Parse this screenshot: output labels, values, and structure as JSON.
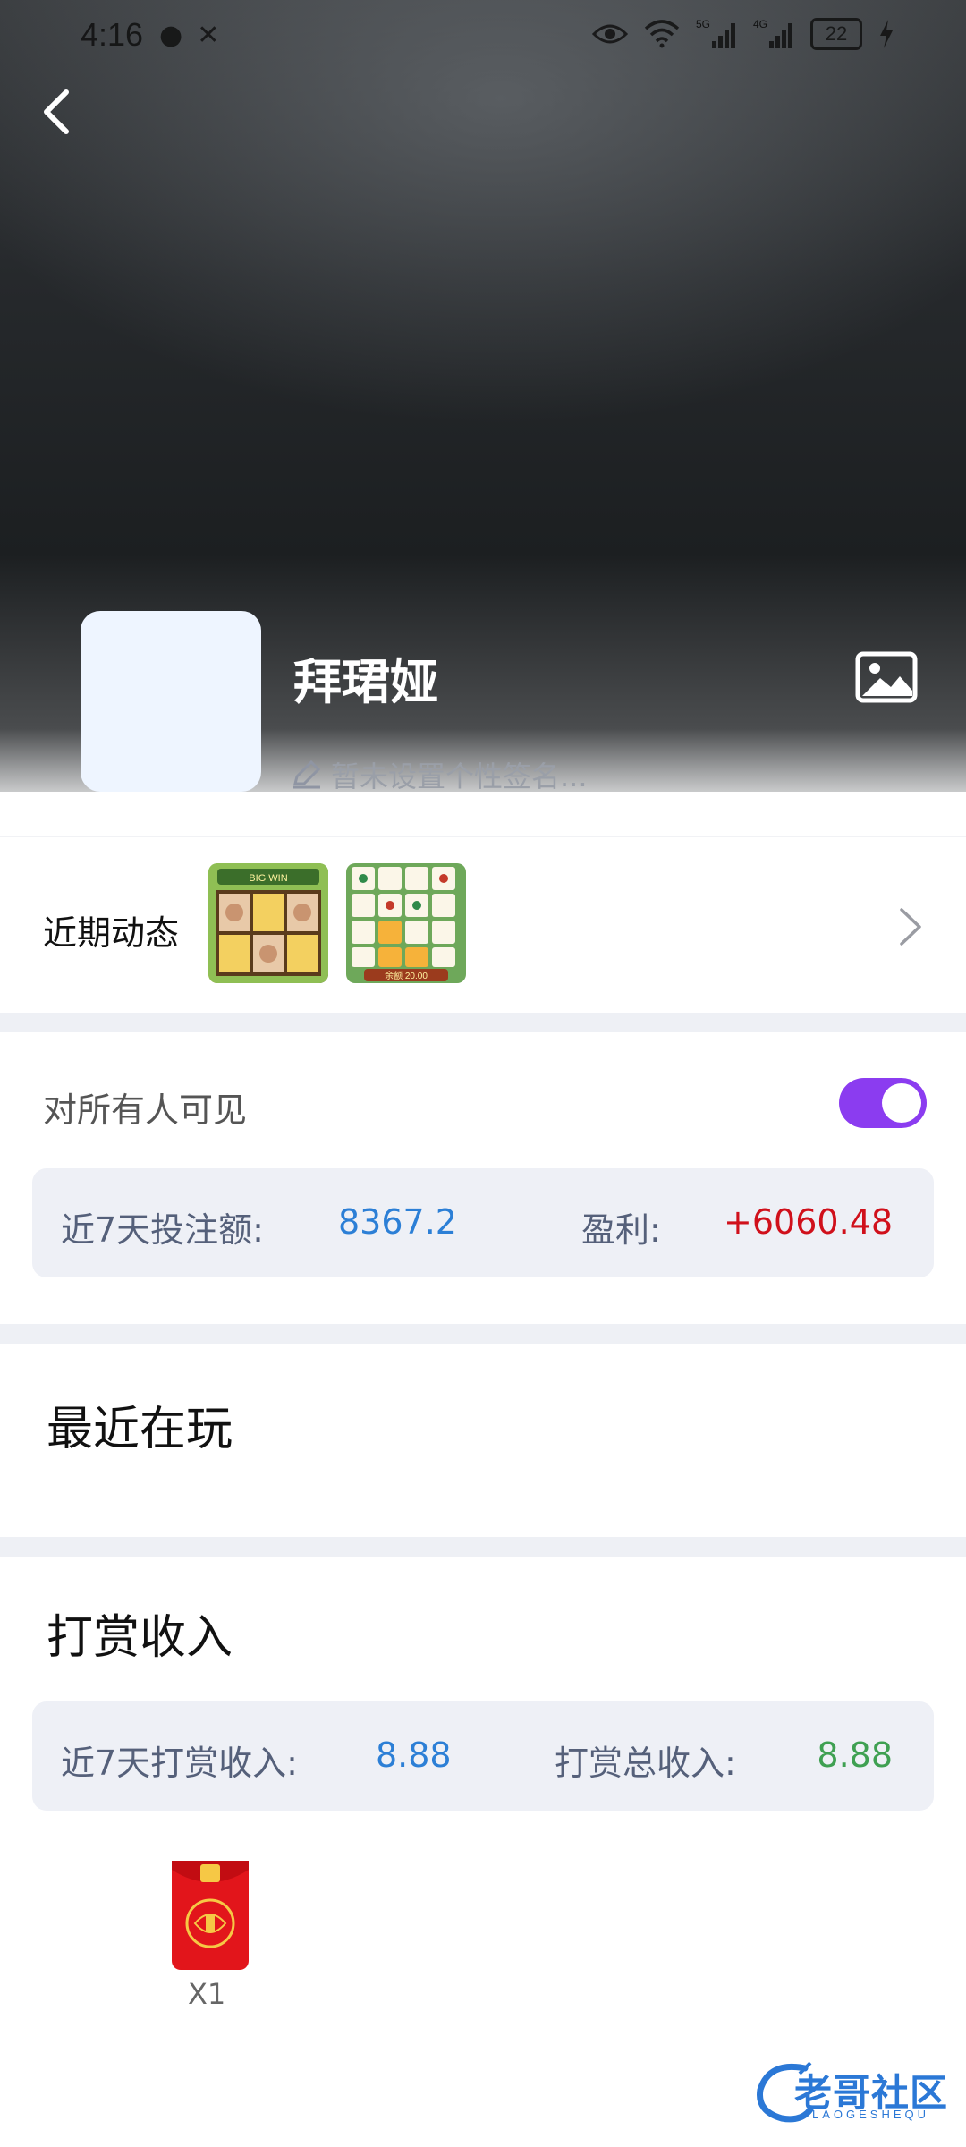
{
  "status_bar": {
    "time": "4:16",
    "battery": "22",
    "network_5g": "5G",
    "network_4g": "4G"
  },
  "profile": {
    "username": "拜珺娅",
    "signature_placeholder": "暂未设置个性签名..."
  },
  "recent_activity": {
    "label": "近期动态",
    "thumbnails": [
      {
        "name": "slot-game-thumbnail",
        "banner": "BIG WIN"
      },
      {
        "name": "mahjong-game-thumbnail",
        "price": "余额 20.00"
      }
    ]
  },
  "visibility": {
    "label": "对所有人可见",
    "enabled": true,
    "accent": "#8b3cf0"
  },
  "bet_stats": {
    "bet_label": "近7天投注额:",
    "bet_value": "8367.2",
    "profit_label": "盈利:",
    "profit_value": "+6060.48",
    "bet_color": "#2c7fd6",
    "profit_color": "#d0101b"
  },
  "recently_playing": {
    "title": "最近在玩"
  },
  "tip_income": {
    "title": "打赏收入",
    "week_label": "近7天打赏收入:",
    "week_value": "8.88",
    "total_label": "打赏总收入:",
    "total_value": "8.88",
    "week_color": "#2c7fd6",
    "total_color": "#3fa052",
    "gifts": [
      {
        "icon": "red-packet-icon",
        "count": "X1"
      }
    ]
  },
  "watermark": {
    "text": "老哥社区",
    "sub": "LAOGESHEQU"
  }
}
